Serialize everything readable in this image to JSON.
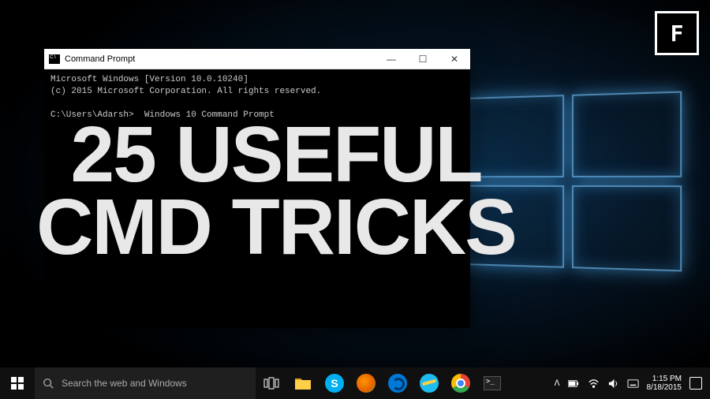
{
  "logo_badge": "F",
  "cmd": {
    "title": "Command Prompt",
    "minimize": "—",
    "maximize": "☐",
    "close": "✕",
    "line1": "Microsoft Windows [Version 10.0.10240]",
    "line2": "(c) 2015 Microsoft Corporation. All rights reserved.",
    "prompt": "C:\\Users\\Adarsh>  Windows 10 Command Prompt"
  },
  "headline": {
    "line1": "25 USEFUL",
    "line2": "CMD TRICKS"
  },
  "taskbar": {
    "search_placeholder": "Search the web and Windows"
  },
  "tray": {
    "up": "ᐱ",
    "time": "1:15 PM",
    "date": "8/18/2015"
  },
  "icons": {
    "explorer": "folder-icon",
    "skype": "skype-icon",
    "firefox": "firefox-icon",
    "edge": "edge-icon",
    "ie": "ie-icon",
    "chrome": "chrome-icon",
    "terminal": "terminal-icon",
    "taskview": "taskview-icon"
  }
}
